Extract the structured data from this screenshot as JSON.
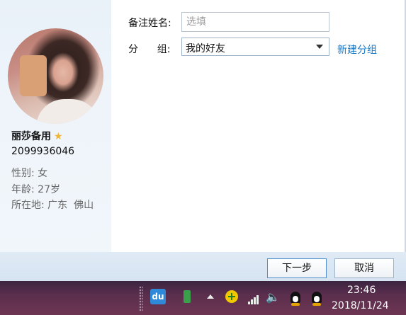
{
  "profile": {
    "nickname": "丽莎备用",
    "star_icon": "star-icon",
    "qq_number": "2099936046",
    "gender": "性别: 女",
    "age": "年龄: 27岁",
    "location": "所在地: 广东  佛山"
  },
  "form": {
    "remark_label": "备注姓名:",
    "remark_placeholder": "选填",
    "group_label": "分      组:",
    "group_value": "我的好友",
    "new_group_link": "新建分组"
  },
  "buttons": {
    "next": "下一步",
    "cancel": "取消"
  },
  "taskbar": {
    "du_label": "du",
    "plus_label": "+",
    "speaker_label": "🔈",
    "time": "23:46",
    "date": "2018/11/24"
  },
  "colors": {
    "link": "#1a79c6",
    "star": "#f0b43a",
    "taskbar": "#5a2e4d"
  }
}
